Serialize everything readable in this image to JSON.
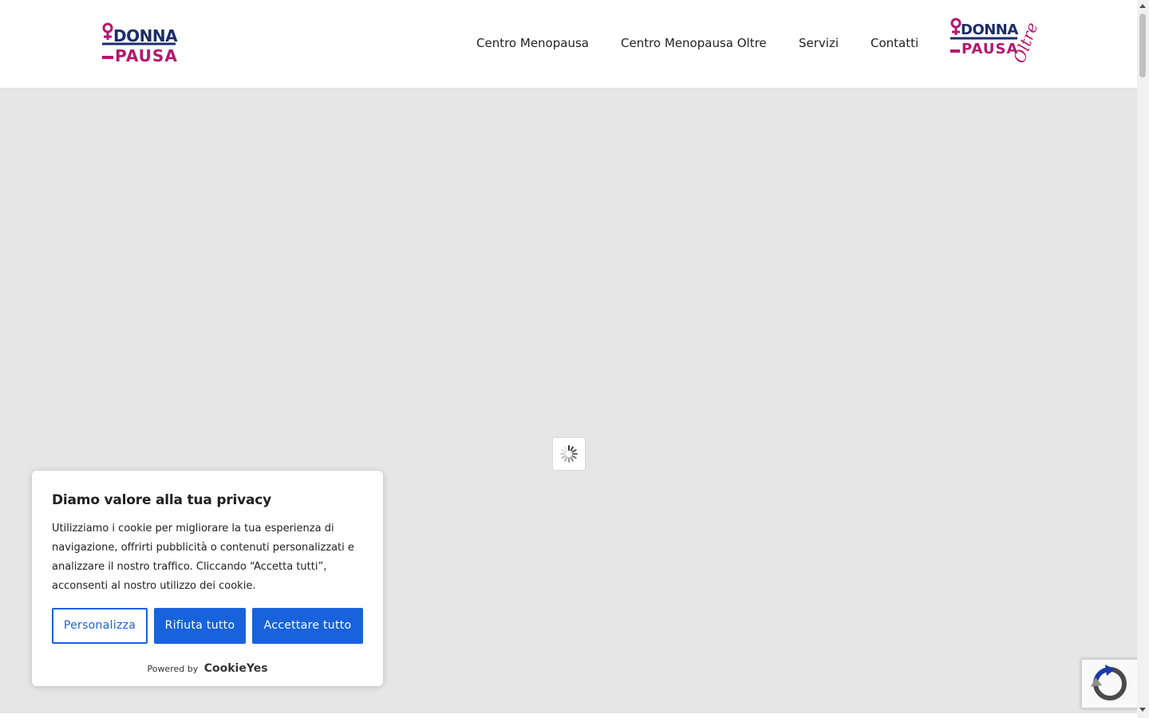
{
  "header": {
    "logo": {
      "line1": "DONNA",
      "line2": "PAUSA"
    },
    "logo_oltre": {
      "line1": "DONNA",
      "line2": "PAUSA",
      "script": "Oltre"
    },
    "nav": [
      {
        "label": "Centro Menopausa"
      },
      {
        "label": "Centro Menopausa Oltre"
      },
      {
        "label": "Servizi"
      },
      {
        "label": "Contatti"
      }
    ]
  },
  "main": {
    "loader_icon": "spinner-icon"
  },
  "cookie_banner": {
    "title": "Diamo valore alla tua privacy",
    "text": "Utilizziamo i cookie per migliorare la tua esperienza di navigazione, offrirti pubblicità o contenuti personalizzati e analizzare il nostro traffico. Cliccando “Accetta tutti”, acconsenti al nostro utilizzo dei cookie.",
    "buttons": {
      "customize": "Personalizza",
      "reject": "Rifiuta tutto",
      "accept": "Accettare tutto"
    },
    "powered_by": "Powered by",
    "brand": "CookieYes"
  },
  "colors": {
    "brand_magenta": "#b5166f",
    "brand_navy": "#1b2d6b",
    "accent_blue": "#1863dc",
    "page_gray": "#e6e6e6"
  }
}
